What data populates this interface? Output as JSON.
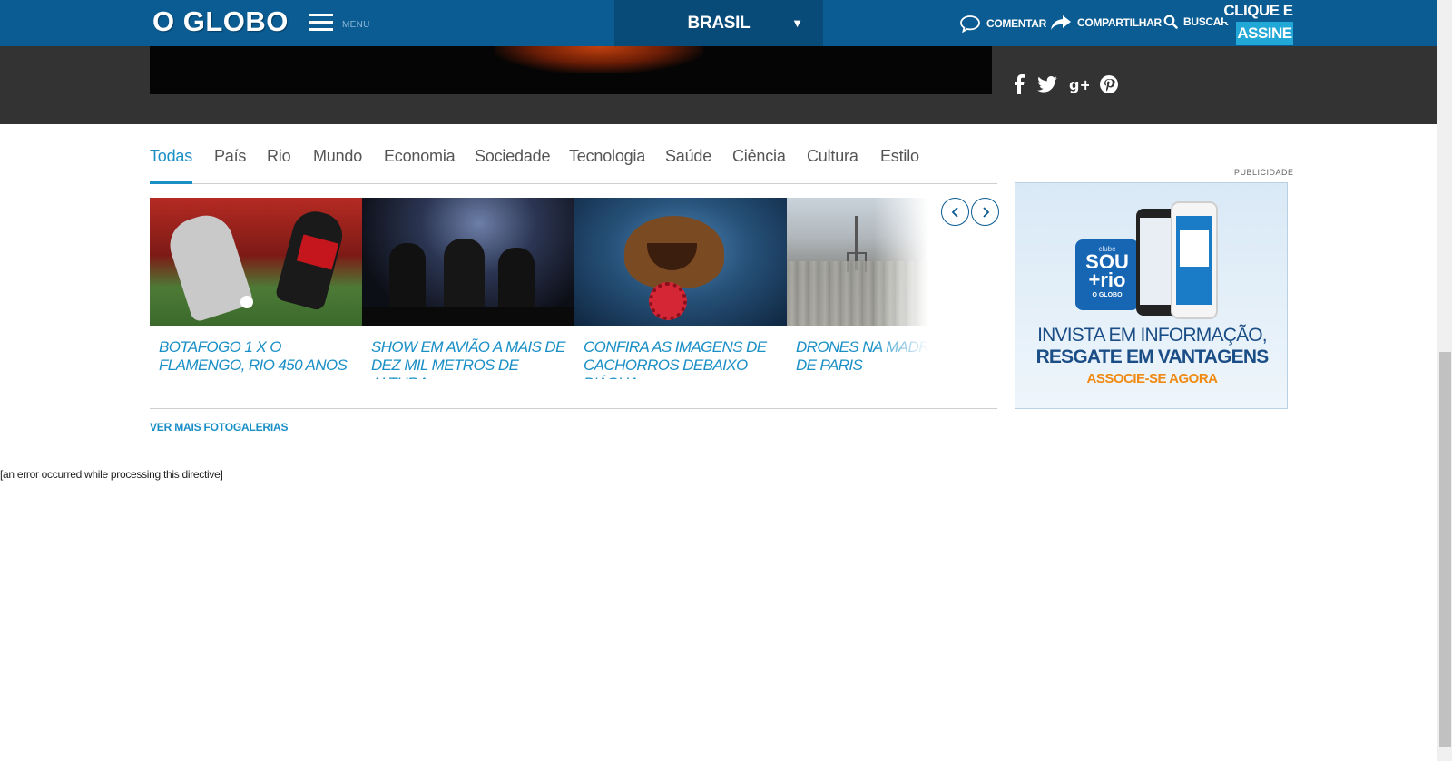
{
  "header": {
    "logo": "O GLOBO",
    "menu_label": "MENU",
    "section": "BRASIL",
    "section_caret": "▼",
    "actions": [
      {
        "label": "COMENTAR",
        "icon": "speech-bubble-icon"
      },
      {
        "label": "COMPARTILHAR",
        "icon": "share-arrow-icon"
      },
      {
        "label": "BUSCAR",
        "icon": "search-icon"
      }
    ],
    "subscribe": {
      "line1": "CLIQUE E",
      "line2": "ASSINE"
    }
  },
  "social": [
    "facebook-icon",
    "twitter-icon",
    "google-plus-icon",
    "pinterest-icon"
  ],
  "tabs": [
    {
      "label": "Todas",
      "active": true
    },
    {
      "label": "País"
    },
    {
      "label": "Rio"
    },
    {
      "label": "Mundo"
    },
    {
      "label": "Economia"
    },
    {
      "label": "Sociedade"
    },
    {
      "label": "Tecnologia"
    },
    {
      "label": "Saúde"
    },
    {
      "label": "Ciência"
    },
    {
      "label": "Cultura"
    },
    {
      "label": "Estilo"
    }
  ],
  "gallery": [
    {
      "caption": "BOTAFOGO 1 X O FLAMENGO, RIO 450 ANOS"
    },
    {
      "caption": "SHOW EM AVIÃO A MAIS DE DEZ MIL METROS DE ALTURA"
    },
    {
      "caption": "CONFIRA AS IMAGENS DE CACHORROS DEBAIXO D'ÁGUA"
    },
    {
      "caption": "DRONES NA MADRUGADA DE PARIS"
    }
  ],
  "more_link": "VER MAIS FOTOGALERIAS",
  "error_text": "[an error occurred while processing this directive]",
  "ad": {
    "label": "PUBLICIDADE",
    "badge_small": "clube",
    "badge_big_1": "SOU",
    "badge_big_2": "+rio",
    "badge_tiny": "O GLOBO",
    "line1": "INVISTA EM INFORMAÇÃO,",
    "line2": "RESGATE EM VANTAGENS",
    "line3": "ASSOCIE-SE AGORA"
  },
  "colors": {
    "header_blue": "#0a5c93",
    "accent_blue": "#1a8fc6",
    "dark_band": "#333333",
    "subscribe_cyan": "#22a8d6"
  }
}
